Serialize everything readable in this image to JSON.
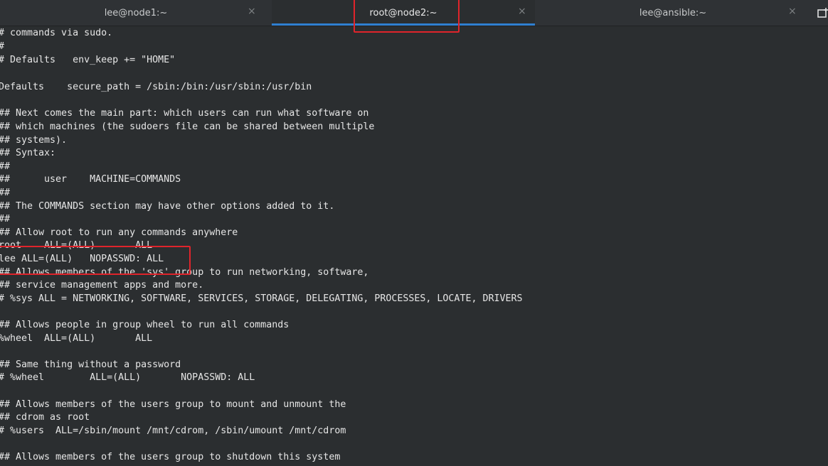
{
  "tabs": [
    {
      "label": "lee@node1:~",
      "close": "×"
    },
    {
      "label": "root@node2:~",
      "close": "×"
    },
    {
      "label": "lee@ansible:~",
      "close": "×"
    }
  ],
  "new_tab_icon": "new-tab-icon",
  "colors": {
    "highlight": "#e0242b",
    "accent": "#2f7fd0",
    "background": "#2b2e30"
  },
  "terminal": {
    "lines": [
      "# commands via sudo.",
      "#",
      "# Defaults   env_keep += \"HOME\"",
      "",
      "Defaults    secure_path = /sbin:/bin:/usr/sbin:/usr/bin",
      "",
      "## Next comes the main part: which users can run what software on",
      "## which machines (the sudoers file can be shared between multiple",
      "## systems).",
      "## Syntax:",
      "##",
      "##      user    MACHINE=COMMANDS",
      "##",
      "## The COMMANDS section may have other options added to it.",
      "##",
      "## Allow root to run any commands anywhere",
      "root    ALL=(ALL)       ALL",
      "lee ALL=(ALL)   NOPASSWD: ALL",
      "## Allows members of the 'sys' group to run networking, software,",
      "## service management apps and more.",
      "# %sys ALL = NETWORKING, SOFTWARE, SERVICES, STORAGE, DELEGATING, PROCESSES, LOCATE, DRIVERS",
      "",
      "## Allows people in group wheel to run all commands",
      "%wheel  ALL=(ALL)       ALL",
      "",
      "## Same thing without a password",
      "# %wheel        ALL=(ALL)       NOPASSWD: ALL",
      "",
      "## Allows members of the users group to mount and unmount the",
      "## cdrom as root",
      "# %users  ALL=/sbin/mount /mnt/cdrom, /sbin/umount /mnt/cdrom",
      "",
      "## Allows members of the users group to shutdown this system"
    ]
  }
}
